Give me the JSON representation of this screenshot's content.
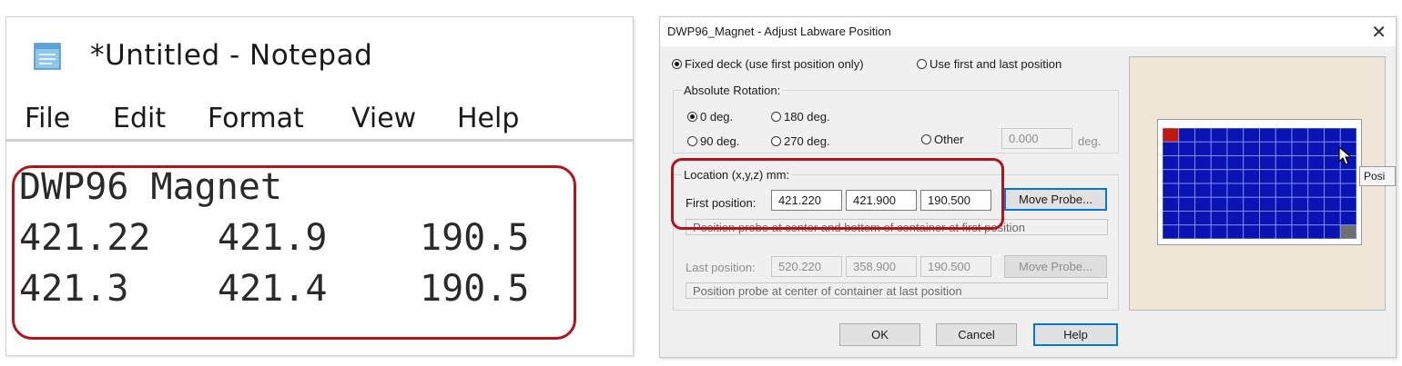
{
  "notepad": {
    "title": "*Untitled - Notepad",
    "menu": [
      "File",
      "Edit",
      "Format",
      "View",
      "Help"
    ],
    "lines": [
      [
        "DWP96 Magnet"
      ],
      [
        "421.22",
        "421.9",
        "190.5"
      ],
      [
        "421.3",
        "421.4",
        "190.5"
      ]
    ]
  },
  "dialog": {
    "title": "DWP96_Magnet - Adjust Labware Position",
    "close_icon": "close-icon",
    "mode": {
      "fixed_label": "Fixed deck (use first position only)",
      "fixed_selected": true,
      "first_last_label": "Use first and last position"
    },
    "rotation": {
      "group_label": "Absolute Rotation:",
      "options": [
        "0 deg.",
        "180 deg.",
        "90 deg.",
        "270 deg."
      ],
      "selected": "0 deg.",
      "other_label": "Other",
      "other_value": "0.000",
      "other_unit": "deg."
    },
    "location": {
      "group_label": "Location (x,y,z) mm:",
      "first_label": "First position:",
      "first": [
        "421.220",
        "421.900",
        "190.500"
      ],
      "first_button": "Move Probe...",
      "first_hint": "Position probe at center and bottom of container at first position",
      "last_label": "Last position:",
      "last": [
        "520.220",
        "358.900",
        "190.500"
      ],
      "last_button": "Move Probe...",
      "last_hint": "Position probe at center of container at last position"
    },
    "buttons": {
      "ok": "OK",
      "cancel": "Cancel",
      "help": "Help"
    },
    "preview": {
      "plate_rows": 8,
      "plate_cols": 12,
      "well_color": "#0a14b4",
      "first_well_color": "#c0180c",
      "last_well_color": "#6e6e6e",
      "tooltip": "Posi"
    }
  },
  "colors": {
    "highlight": "#b3141c",
    "default_button_border": "#0078d7"
  }
}
